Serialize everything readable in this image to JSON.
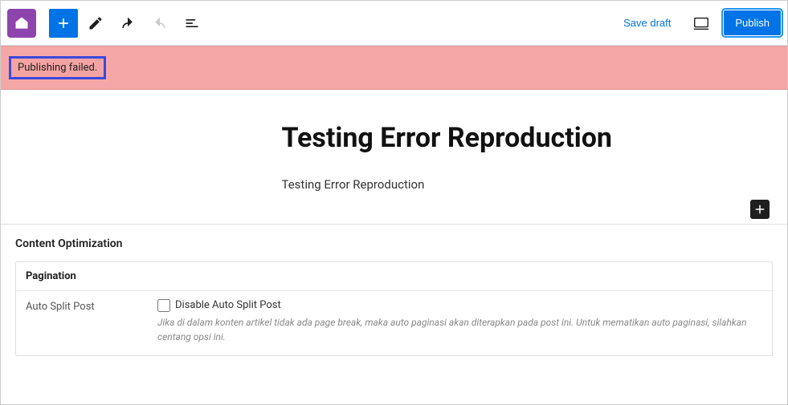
{
  "toolbar": {
    "save_draft": "Save draft",
    "publish": "Publish"
  },
  "error": {
    "message": "Publishing failed."
  },
  "post": {
    "title": "Testing Error Reproduction",
    "body": "Testing Error Reproduction"
  },
  "content_optimization": {
    "title": "Content Optimization",
    "pagination": {
      "title": "Pagination",
      "auto_split": {
        "label": "Auto Split Post",
        "checkbox_label": "Disable Auto Split Post",
        "help": "Jika di dalam konten artikel tidak ada page break, maka auto paginasi akan diterapkan pada post ini. Untuk mematikan auto paginasi, silahkan centang opsi ini."
      }
    }
  }
}
